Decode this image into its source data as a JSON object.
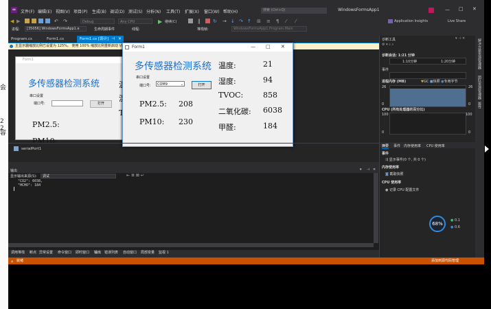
{
  "left_edge": {
    "chars": [
      "会",
      "2",
      "2",
      "容"
    ]
  },
  "window": {
    "title": "WindowsFormsApp1",
    "search_placeholder": "搜索 (Ctrl+Q)",
    "account": "Application Insights",
    "live_share": "Live Share"
  },
  "menu": [
    "文件(F)",
    "编辑(E)",
    "视图(V)",
    "项目(P)",
    "生成(B)",
    "调试(D)",
    "测试(S)",
    "分析(N)",
    "工具(T)",
    "扩展(X)",
    "窗口(W)",
    "帮助(H)"
  ],
  "toolbar": {
    "config": "Debug",
    "platform": "Any CPU",
    "continue": "继续(C)"
  },
  "process": {
    "label": "进程:",
    "value": "[35056] WindowsFormsApp1.e",
    "event_label": "生命周期事件",
    "thread_label": "线程:",
    "stack_label": "堆栈帧:",
    "stack_value": "WindowsFormsApp1.Program.Main"
  },
  "tabs": [
    "Program.cs",
    "Form1.cs",
    "Form1.cs [设计]"
  ],
  "infobar": "主显示器缩放比例已设置为 125%。 使用 100% 缩放比例重新启动 Visual Studio",
  "designer": {
    "back_title": "Form1",
    "back_heading": "多传感器检测系统",
    "back_serial_group": "串口设置",
    "back_port_label": "端口号:",
    "back_open_btn": "打开",
    "back_pm25": "PM2.5:",
    "back_pm10": "PM10:",
    "back_t": "T",
    "back_w": "温",
    "back_sh": "湿",
    "component": "serialPort1"
  },
  "form1": {
    "title": "Form1",
    "heading": "多传感器检测系统",
    "serial_group": "串口设置",
    "port_label": "端口号:",
    "port_value": "COM9",
    "open_button": "打开",
    "pm25_label": "PM2.5:",
    "pm25_value": "208",
    "pm10_label": "PM10:",
    "pm10_value": "230",
    "temp_label": "温度:",
    "temp_value": "21",
    "hum_label": "湿度:",
    "hum_value": "94",
    "tvoc_label": "TVOC:",
    "tvoc_value": "858",
    "co2_label": "二氧化碳:",
    "co2_value": "6038",
    "hcho_label": "甲醛:",
    "hcho_value": "184"
  },
  "output": {
    "title": "输出",
    "source_label": "显示输出来源(S):",
    "source_value": "调试",
    "line1": "\"CO2\": 6038,",
    "line2": "\"HCHO\": 184"
  },
  "bottom_tabs": [
    "调用堆栈",
    "断点",
    "异常设置",
    "命令窗口",
    "即时窗口",
    "输出",
    "错误列表",
    "自动窗口",
    "局部变量",
    "监视 1"
  ],
  "status": {
    "left": "就绪",
    "right": "添加到源代码管理"
  },
  "diag": {
    "title": "诊断工具",
    "session": "诊断会话: 1:21 分钟",
    "t1": "1:10分钟",
    "t2": "1:20分钟",
    "events": "事件",
    "memory_title": "进程内存 (MB)",
    "gc": "GC",
    "snapshot": "快照",
    "private": "专用字节",
    "mem_top": "26",
    "mem_bottom": "0",
    "cpu_title": "CPU (所有处理器的百分比)",
    "cpu_top": "100",
    "cpu_bottom": "0",
    "tabs": [
      "摘要",
      "事件",
      "内存使用率",
      "CPU 使用率"
    ],
    "events2": "事件",
    "show_events": "显示事件(0 个, 共 0 个)",
    "mem_usage": "内存使用率",
    "take_snapshot": "截取快照",
    "cpu_usage": "CPU 使用率",
    "record_cpu": "记录 CPU 配置文件",
    "gauge": "68%",
    "net_up": "0.1",
    "net_down": "0.6"
  },
  "right_strip": [
    "解决方案资源管理器",
    "团队资源管理器",
    "属性"
  ]
}
